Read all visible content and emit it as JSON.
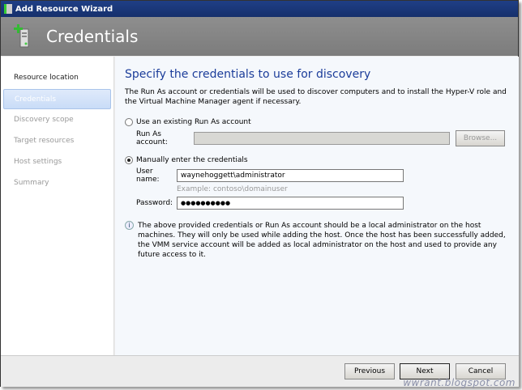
{
  "window": {
    "title": "Add Resource Wizard"
  },
  "header": {
    "title": "Credentials"
  },
  "nav": {
    "items": [
      {
        "label": "Resource location",
        "state": "done"
      },
      {
        "label": "Credentials",
        "state": "active"
      },
      {
        "label": "Discovery scope",
        "state": "pending"
      },
      {
        "label": "Target resources",
        "state": "pending"
      },
      {
        "label": "Host settings",
        "state": "pending"
      },
      {
        "label": "Summary",
        "state": "pending"
      }
    ]
  },
  "main": {
    "heading": "Specify the credentials to use for discovery",
    "description": "The Run As account or credentials will be used to discover computers and to install the Hyper-V role and the Virtual Machine Manager agent if necessary.",
    "option_existing": "Use an existing Run As account",
    "runas_label": "Run As account:",
    "runas_value": "",
    "browse_label": "Browse...",
    "option_manual": "Manually enter the credentials",
    "username_label": "User name:",
    "username_value": "waynehoggett\\administrator",
    "username_example": "Example: contoso\\domainuser",
    "password_label": "Password:",
    "password_value": "●●●●●●●●●●",
    "info": "The above provided credentials or Run As account should be a local administrator on the host machines. They will only be used while adding the host. Once the host has been successfully added, the VMM service account will be added as local administrator on the host and used to provide any future access to it."
  },
  "footer": {
    "previous": "Previous",
    "next": "Next",
    "cancel": "Cancel"
  },
  "watermark": "wwrant.blogspot.com"
}
